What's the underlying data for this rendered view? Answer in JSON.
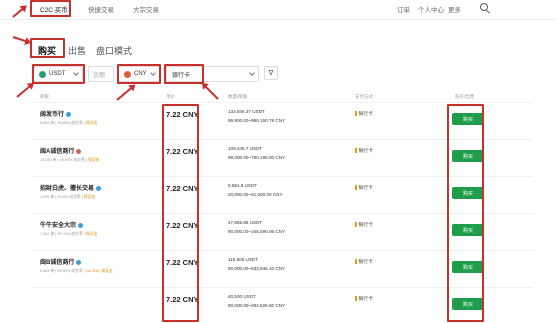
{
  "topnav": {
    "items": [
      "C2C 买币",
      "快捷交易",
      "大宗交易"
    ],
    "right": [
      "订单",
      "个人中心",
      "更多"
    ]
  },
  "tabs": [
    "购买",
    "出售",
    "盘口模式"
  ],
  "filters": {
    "coin": "USDT",
    "amount_placeholder": "金额",
    "fiat": "CNY",
    "payment": "银行卡",
    "filter_icon": "∇"
  },
  "table": {
    "headers": [
      "商家",
      "单价",
      "数量/限额",
      "支付方式",
      "购买/出售"
    ],
    "buy_label": "购买",
    "rows": [
      {
        "name": "阔发币行",
        "badge_color": "#3a9fd6",
        "stats": "5,669 单 | 99.88% 成交率 |",
        "pay_tag": "保证金",
        "price": "7.22 CNY",
        "amount": "132,846.37 USDT",
        "limit": "99,900.00~959,150.79 CNY",
        "method": "银行卡"
      },
      {
        "name": "闽A诚信商行",
        "badge_color": "#e45b5b",
        "stats": "15,290 单 | 99.93% 成交率 |",
        "pay_tag": "保证金",
        "price": "7.22 CNY",
        "amount": "109,445.7 USDT",
        "limit": "99,000.00~790,198.00 CNY",
        "method": "银行卡"
      },
      {
        "name": "招财白虎、擅长交易",
        "badge_color": "#3a9fd6",
        "stats": "1,999 单 | 99.8% 成交率 |",
        "pay_tag": "保证金",
        "price": "7.22 CNY",
        "amount": "9,691.8 USDT",
        "limit": "20,000.00~61,000.00 CNY",
        "method": "银行卡"
      },
      {
        "name": "牛牛安全大宗",
        "badge_color": "#3a9fd6",
        "stats": "7,302 单 | 99.76% 成交率 |",
        "pay_tag": "保证金",
        "price": "7.22 CNY",
        "amount": "47,865.66 USDT",
        "limit": "90,000.00~345,590.06 CNY",
        "method": "银行卡"
      },
      {
        "name": "闽B诚信商行",
        "badge_color": "#3a9fd6",
        "stats": "5,683 单 | 99.85% 成交率 |",
        "pay_tag": "1m 20s | 保证金",
        "price": "7.22 CNY",
        "amount": "115,505 USDT",
        "limit": "90,000.00~833,946.10 CNY",
        "method": "银行卡"
      },
      {
        "name": "",
        "badge_color": "",
        "stats": "",
        "pay_tag": "",
        "price": "7.22 CNY",
        "amount": "40,530 USDT",
        "limit": "90,000.00~292,626.60 CNY",
        "method": "银行卡"
      }
    ]
  },
  "colors": {
    "annotation_red": "#c9302c",
    "buy_green": "#1e9e4a",
    "usdt_green": "#26a17b",
    "cny_red": "#e45b3a"
  }
}
